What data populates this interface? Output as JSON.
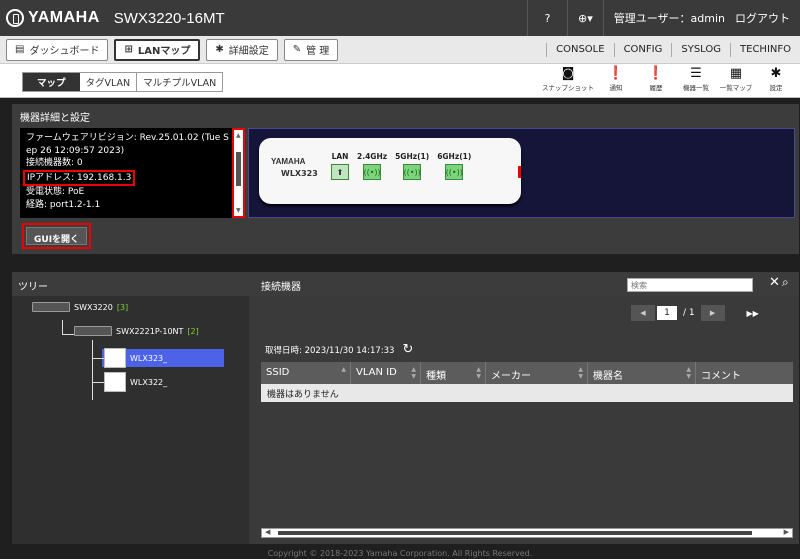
{
  "header": {
    "brand": "YAMAHA",
    "model": "SWX3220-16MT",
    "help": "?",
    "user": "管理ユーザー：admin",
    "logout": "ログアウト"
  },
  "tabs": [
    {
      "label": "ダッシュボード",
      "icon": "▤"
    },
    {
      "label": "LANマップ",
      "icon": "⊞"
    },
    {
      "label": "詳細設定",
      "icon": "✱"
    },
    {
      "label": "管 理",
      "icon": "🔧"
    }
  ],
  "links": [
    "CONSOLE",
    "CONFIG",
    "SYSLOG",
    "TECHINFO"
  ],
  "subtabs": [
    "マップ",
    "タグVLAN",
    "マルチプルVLAN"
  ],
  "tools": [
    "スナップショット",
    "通知",
    "履歴",
    "機器一覧",
    "一覧マップ",
    "設定"
  ],
  "detail": {
    "title": "機器詳細と設定",
    "info": [
      "ファームウェアリビジョン: Rev.25.01.02 (Tue S",
      "ep 26 12:09:57 2023)",
      "接続機器数: 0",
      "IPアドレス: 192.168.1.3",
      "受電状態: PoE",
      "経路: port1.2-1.1"
    ],
    "device_brand": "YAMAHA",
    "device_model": "WLX323",
    "ports": [
      "LAN",
      "2.4GHz",
      "5GHz(1)",
      "6GHz(1)"
    ],
    "gui_button": "GUIを開く"
  },
  "tree": {
    "title": "ツリー",
    "nodes": [
      {
        "name": "SWX3220",
        "count": "[3]"
      },
      {
        "name": "SWX2221P-10NT",
        "count": "[2]"
      },
      {
        "name": "WLX323_"
      },
      {
        "name": "WLX322_"
      }
    ]
  },
  "connected": {
    "title": "接続機器",
    "search_placeholder": "検索",
    "page": "1",
    "of": "/ 1",
    "timestamp": "取得日時: 2023/11/30 14:17:33",
    "columns": [
      "SSID",
      "VLAN ID",
      "種類",
      "メーカー",
      "機器名",
      "コメント"
    ],
    "empty": "機器はありません"
  },
  "footer": "Copyright © 2018-2023 Yamaha Corporation. All Rights Reserved."
}
